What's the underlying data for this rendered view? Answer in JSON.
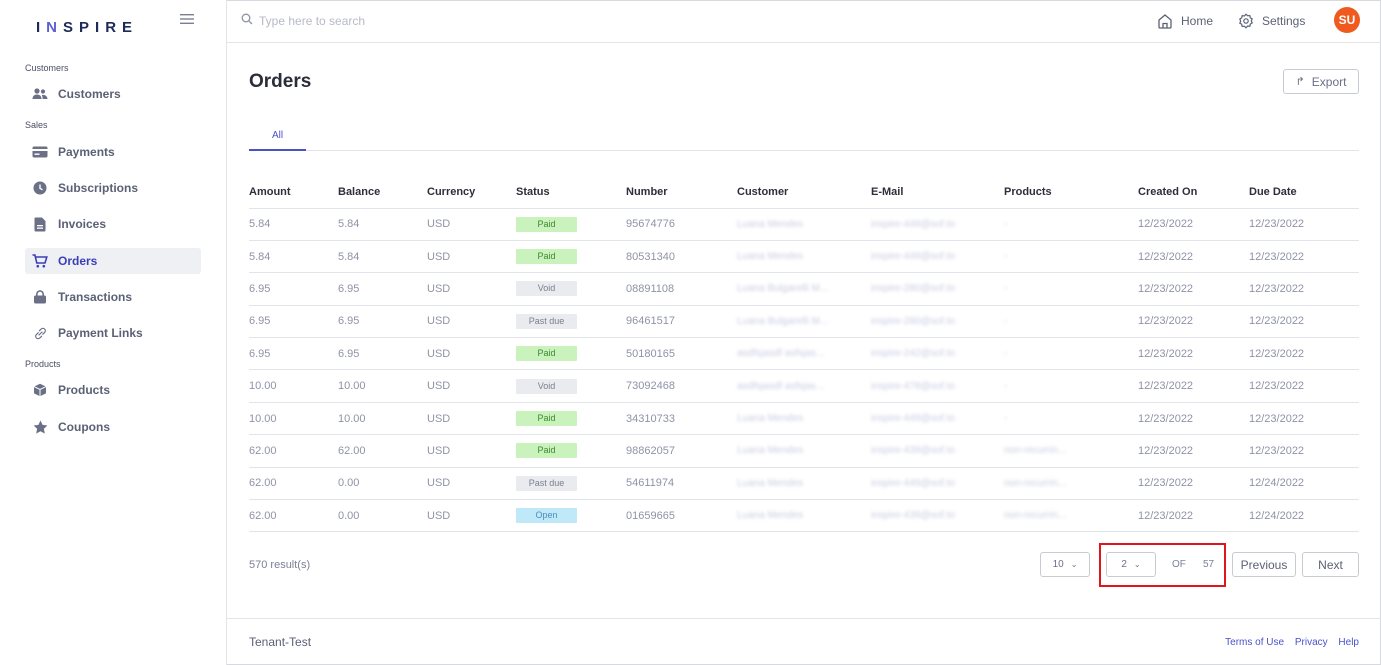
{
  "app": {
    "logo_pre": "I",
    "logo_n": "N",
    "logo_post": "SPIRE"
  },
  "sidebar": {
    "sections": [
      {
        "label": "Customers"
      },
      {
        "label": "Sales"
      },
      {
        "label": "Products"
      }
    ],
    "items": [
      {
        "label": "Customers",
        "icon": "users-icon"
      },
      {
        "label": "Payments",
        "icon": "credit-card-icon"
      },
      {
        "label": "Subscriptions",
        "icon": "clock-icon"
      },
      {
        "label": "Invoices",
        "icon": "file-icon"
      },
      {
        "label": "Orders",
        "icon": "cart-icon",
        "active": true
      },
      {
        "label": "Transactions",
        "icon": "lock-icon"
      },
      {
        "label": "Payment Links",
        "icon": "link-icon"
      },
      {
        "label": "Products",
        "icon": "box-icon"
      },
      {
        "label": "Coupons",
        "icon": "star-icon"
      }
    ]
  },
  "topbar": {
    "search_placeholder": "Type here to search",
    "home_label": "Home",
    "settings_label": "Settings",
    "avatar_initials": "SU"
  },
  "page": {
    "title": "Orders",
    "export_label": "Export",
    "tab_all": "All"
  },
  "table": {
    "columns": [
      "Amount",
      "Balance",
      "Currency",
      "Status",
      "Number",
      "Customer",
      "E-Mail",
      "Products",
      "Created On",
      "Due Date"
    ],
    "rows": [
      {
        "amount": "5.84",
        "balance": "5.84",
        "currency": "USD",
        "status": "Paid",
        "number": "95674776",
        "customer": "Luana Mendes",
        "email": "inspire-449@sof.to",
        "products": "-",
        "created": "12/23/2022",
        "due": "12/23/2022"
      },
      {
        "amount": "5.84",
        "balance": "5.84",
        "currency": "USD",
        "status": "Paid",
        "number": "80531340",
        "customer": "Luana Mendes",
        "email": "inspire-449@sof.to",
        "products": "-",
        "created": "12/23/2022",
        "due": "12/23/2022"
      },
      {
        "amount": "6.95",
        "balance": "6.95",
        "currency": "USD",
        "status": "Void",
        "number": "08891108",
        "customer": "Luana Bulgarelli M...",
        "email": "inspire-280@sof.to",
        "products": "-",
        "created": "12/23/2022",
        "due": "12/23/2022"
      },
      {
        "amount": "6.95",
        "balance": "6.95",
        "currency": "USD",
        "status": "Past due",
        "number": "96461517",
        "customer": "Luana Bulgarelli M...",
        "email": "inspire-280@sof.to",
        "products": "-",
        "created": "12/23/2022",
        "due": "12/23/2022"
      },
      {
        "amount": "6.95",
        "balance": "6.95",
        "currency": "USD",
        "status": "Paid",
        "number": "50180165",
        "customer": "asdfsjasdf asfsjas...",
        "email": "inspire-242@sof.to",
        "products": "-",
        "created": "12/23/2022",
        "due": "12/23/2022"
      },
      {
        "amount": "10.00",
        "balance": "10.00",
        "currency": "USD",
        "status": "Void",
        "number": "73092468",
        "customer": "asdfsjasdf asfsjas...",
        "email": "inspire-478@sof.to",
        "products": "-",
        "created": "12/23/2022",
        "due": "12/23/2022"
      },
      {
        "amount": "10.00",
        "balance": "10.00",
        "currency": "USD",
        "status": "Paid",
        "number": "34310733",
        "customer": "Luana Mendes",
        "email": "inspire-449@sof.to",
        "products": "-",
        "created": "12/23/2022",
        "due": "12/23/2022"
      },
      {
        "amount": "62.00",
        "balance": "62.00",
        "currency": "USD",
        "status": "Paid",
        "number": "98862057",
        "customer": "Luana Mendes",
        "email": "inspire-439@sof.to",
        "products": "non-recurrin...",
        "created": "12/23/2022",
        "due": "12/23/2022"
      },
      {
        "amount": "62.00",
        "balance": "0.00",
        "currency": "USD",
        "status": "Past due",
        "number": "54611974",
        "customer": "Luana Mendes",
        "email": "inspire-449@sof.to",
        "products": "non-recurrin...",
        "created": "12/23/2022",
        "due": "12/24/2022"
      },
      {
        "amount": "62.00",
        "balance": "0.00",
        "currency": "USD",
        "status": "Open",
        "number": "01659665",
        "customer": "Luana Mendes",
        "email": "inspire-439@sof.to",
        "products": "non-recurrin...",
        "created": "12/23/2022",
        "due": "12/24/2022"
      }
    ]
  },
  "pagination": {
    "results_text": "570 result(s)",
    "page_size": "10",
    "current_page": "2",
    "of_label": "OF",
    "total_pages": "57",
    "previous_label": "Previous",
    "next_label": "Next"
  },
  "footer": {
    "tenant": "Tenant-Test",
    "terms": "Terms of Use",
    "privacy": "Privacy",
    "help": "Help"
  },
  "colors": {
    "accent": "#4b52c9",
    "avatar": "#f05a1e",
    "paid_bg": "#c9f2bc",
    "open_bg": "#bfe9f8",
    "highlight": "#e0161d"
  }
}
